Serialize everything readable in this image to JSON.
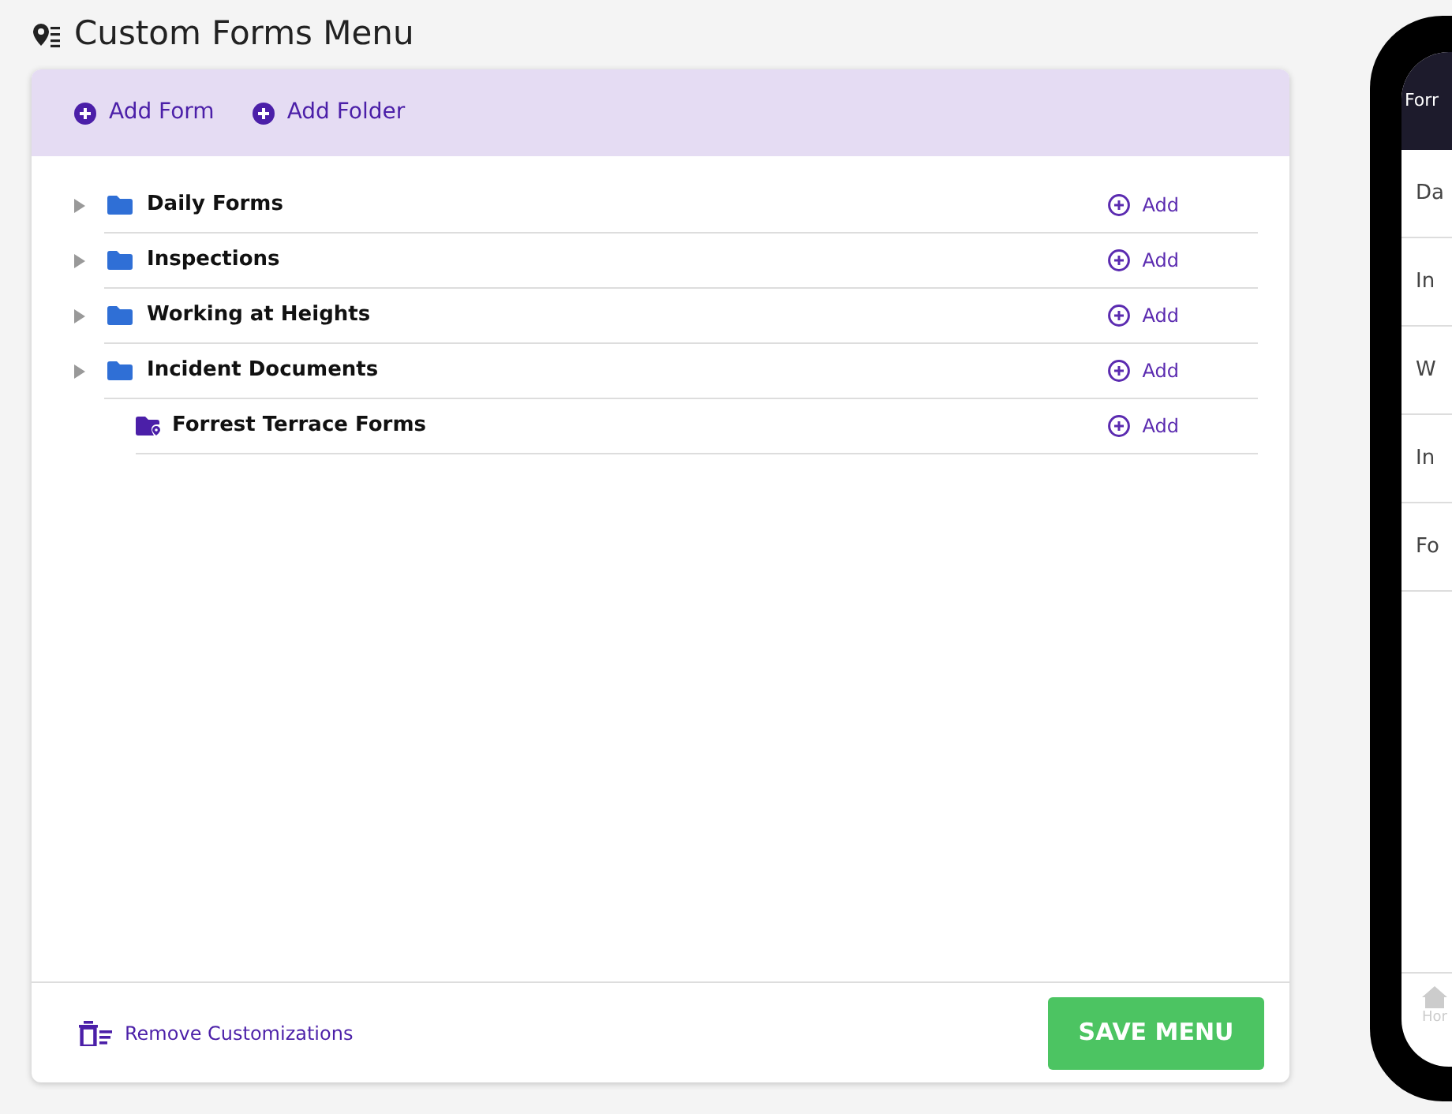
{
  "page": {
    "title": "Custom Forms Menu"
  },
  "toolbar": [
    "Add Form",
    "Add Folder"
  ],
  "items": [
    {
      "kind": "folder",
      "label": "Daily Forms",
      "expandable": true,
      "action": "Add"
    },
    {
      "kind": "folder",
      "label": "Inspections",
      "expandable": true,
      "action": "Add"
    },
    {
      "kind": "folder",
      "label": "Working at Heights",
      "expandable": true,
      "action": "Add"
    },
    {
      "kind": "folder",
      "label": "Incident Documents",
      "expandable": true,
      "action": "Add"
    },
    {
      "kind": "location-folder",
      "label": "Forrest Terrace Forms",
      "expandable": false,
      "action": "Add"
    }
  ],
  "footer": {
    "remove": "Remove Customizations",
    "save": "SAVE MENU"
  },
  "phone_preview": {
    "header": "Forr",
    "items": [
      "Da",
      "In",
      "W",
      "In",
      "Fo"
    ],
    "nav": "Hor"
  }
}
